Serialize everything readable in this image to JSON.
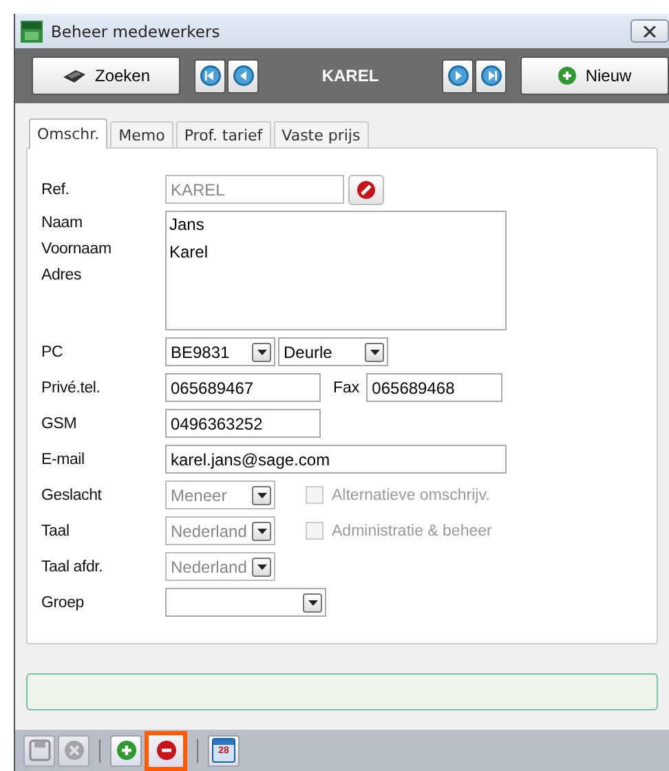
{
  "window": {
    "title": "Beheer medewerkers"
  },
  "toolbar": {
    "search_button": "Zoeken",
    "record": "KAREL",
    "new_button": "Nieuw"
  },
  "tabs": [
    {
      "label": "Omschr.",
      "selected": true
    },
    {
      "label": "Memo",
      "selected": false
    },
    {
      "label": "Prof. tarief",
      "selected": false
    },
    {
      "label": "Vaste prijs",
      "selected": false
    }
  ],
  "rows": [
    {
      "kind": "ref",
      "label": "Ref.",
      "value": "KAREL",
      "disabled": true
    },
    {
      "kind": "memo",
      "labels": [
        "Naam",
        "Voornaam",
        "Adres"
      ],
      "lines": [
        "Jans",
        "Karel"
      ]
    },
    {
      "kind": "postal",
      "label": "PC",
      "code": "BE9831",
      "city": "Deurle"
    },
    {
      "kind": "phone",
      "label": "Privé.tel.",
      "value": "065689467",
      "fax_label": "Fax",
      "fax": "065689468"
    },
    {
      "kind": "short",
      "label": "GSM",
      "value": "0496363252"
    },
    {
      "kind": "wide",
      "label": "E-mail",
      "value": "karel.jans@sage.com"
    },
    {
      "kind": "combo",
      "label": "Geslacht",
      "value": "Meneer",
      "disabled": true,
      "option": {
        "label": "Alternatieve omschrijv.",
        "checked": false,
        "disabled": true
      }
    },
    {
      "kind": "combo",
      "label": "Taal",
      "value": "Nederland",
      "disabled": true,
      "option": {
        "label": "Administratie & beheer",
        "checked": false,
        "disabled": true
      }
    },
    {
      "kind": "combo",
      "label": "Taal afdr.",
      "value": "Nederland",
      "disabled": true
    },
    {
      "kind": "combo-wide",
      "label": "Groep",
      "disabled": false
    }
  ],
  "bottom_tools": [
    {
      "kind": "save",
      "disabled": true,
      "highlighted": false
    },
    {
      "kind": "cancel",
      "disabled": true,
      "highlighted": false
    },
    {
      "kind": "add",
      "disabled": false,
      "highlighted": false
    },
    {
      "kind": "delete",
      "disabled": false,
      "highlighted": true
    },
    {
      "kind": "calendar",
      "disabled": false,
      "highlighted": false,
      "day": "28"
    }
  ]
}
